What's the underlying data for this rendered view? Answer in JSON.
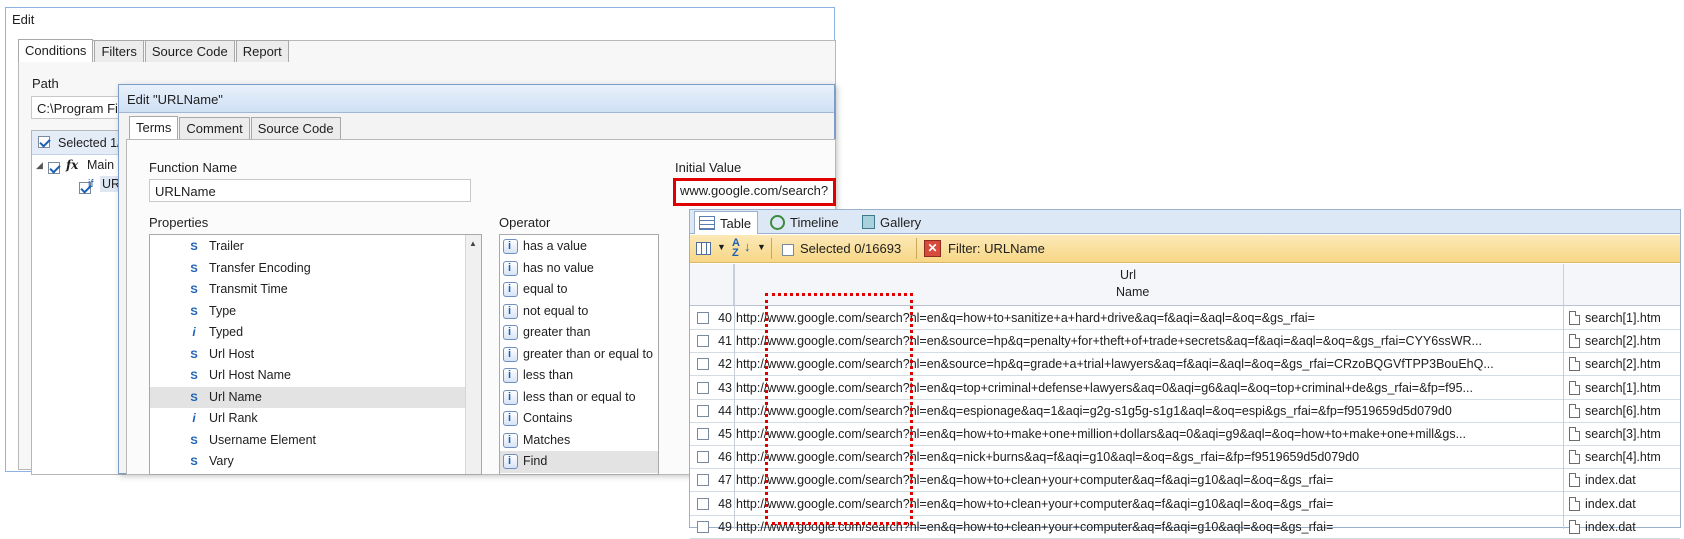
{
  "outer_window": {
    "title": "Edit",
    "tabs": [
      "Conditions",
      "Filters",
      "Source Code",
      "Report"
    ],
    "path_label": "Path",
    "path_value": "C:\\Program Fil",
    "selected_label": "Selected 1/",
    "tree": {
      "main_label": "Main",
      "if_label": "if",
      "url_label": "URI"
    }
  },
  "dialog": {
    "title": "Edit \"URLName\"",
    "tabs": [
      "Terms",
      "Comment",
      "Source Code"
    ],
    "function_name_label": "Function Name",
    "function_name_value": "URLName",
    "initial_value_label": "Initial Value",
    "initial_value_value": "www.google.com/search?",
    "properties_label": "Properties",
    "operator_label": "Operator",
    "properties": [
      {
        "glyph": "S",
        "label": "Trailer"
      },
      {
        "glyph": "S",
        "label": "Transfer Encoding"
      },
      {
        "glyph": "S",
        "label": "Transmit Time"
      },
      {
        "glyph": "S",
        "label": "Type"
      },
      {
        "glyph": "i",
        "label": "Typed"
      },
      {
        "glyph": "S",
        "label": "Url Host"
      },
      {
        "glyph": "S",
        "label": "Url Host Name"
      },
      {
        "glyph": "S",
        "label": "Url Name"
      },
      {
        "glyph": "i",
        "label": "Url Rank"
      },
      {
        "glyph": "S",
        "label": "Username Element"
      },
      {
        "glyph": "S",
        "label": "Vary"
      }
    ],
    "selected_property": "Url Name",
    "operators": [
      "has a value",
      "has no value",
      "equal to",
      "not equal to",
      "greater than",
      "greater than or equal to",
      "less than",
      "less than or equal to",
      "Contains",
      "Matches",
      "Find"
    ],
    "selected_operator": "Find"
  },
  "grid": {
    "tabs": [
      "Table",
      "Timeline",
      "Gallery"
    ],
    "active_tab": "Table",
    "selected_text": "Selected 0/16693",
    "filter_text": "Filter: URLName",
    "col_url": "Url",
    "col_name": "Name",
    "rows": [
      {
        "num": "40",
        "url": "http://www.google.com/search?hl=en&q=how+to+sanitize+a+hard+drive&aq=f&aqi=&aql=&oq=&gs_rfai=",
        "name": "search[1].htm"
      },
      {
        "num": "41",
        "url": "http://www.google.com/search?hl=en&source=hp&q=penalty+for+theft+of+trade+secrets&aq=f&aqi=&aql=&oq=&gs_rfai=CYY6ssWR...",
        "name": "search[2].htm"
      },
      {
        "num": "42",
        "url": "http://www.google.com/search?hl=en&source=hp&q=grade+a+trial+lawyers&aq=f&aqi=&aql=&oq=&gs_rfai=CRzoBQGVfTPP3BouEhQ...",
        "name": "search[2].htm"
      },
      {
        "num": "43",
        "url": "http://www.google.com/search?hl=en&q=top+criminal+defense+lawyers&aq=0&aqi=g6&aql=&oq=top+criminal+de&gs_rfai=&fp=f95...",
        "name": "search[1].htm"
      },
      {
        "num": "44",
        "url": "http://www.google.com/search?hl=en&q=espionage&aq=1&aqi=g2g-s1g5g-s1g1&aql=&oq=espi&gs_rfai=&fp=f9519659d5d079d0",
        "name": "search[6].htm"
      },
      {
        "num": "45",
        "url": "http://www.google.com/search?hl=en&q=how+to+make+one+million+dollars&aq=0&aqi=g9&aql=&oq=how+to+make+one+mill&gs...",
        "name": "search[3].htm"
      },
      {
        "num": "46",
        "url": "http://www.google.com/search?hl=en&q=nick+burns&aq=f&aqi=g10&aql=&oq=&gs_rfai=&fp=f9519659d5d079d0",
        "name": "search[4].htm"
      },
      {
        "num": "47",
        "url": "http://www.google.com/search?hl=en&q=how+to+clean+your+computer&aq=f&aqi=g10&aql=&oq=&gs_rfai=",
        "name": "index.dat"
      },
      {
        "num": "48",
        "url": "http://www.google.com/search?hl=en&q=how+to+clean+your+computer&aq=f&aqi=g10&aql=&oq=&gs_rfai=",
        "name": "index.dat"
      },
      {
        "num": "49",
        "url": "http://www.google.com/search?hl=en&q=how+to+clean+your+computer&aq=f&aqi=g10&aql=&oq=&gs_rfai=",
        "name": "index.dat"
      }
    ]
  },
  "colors": {
    "highlight": "#e00000",
    "toolbar": "#f7d786",
    "accent": "#1a5fb4"
  }
}
